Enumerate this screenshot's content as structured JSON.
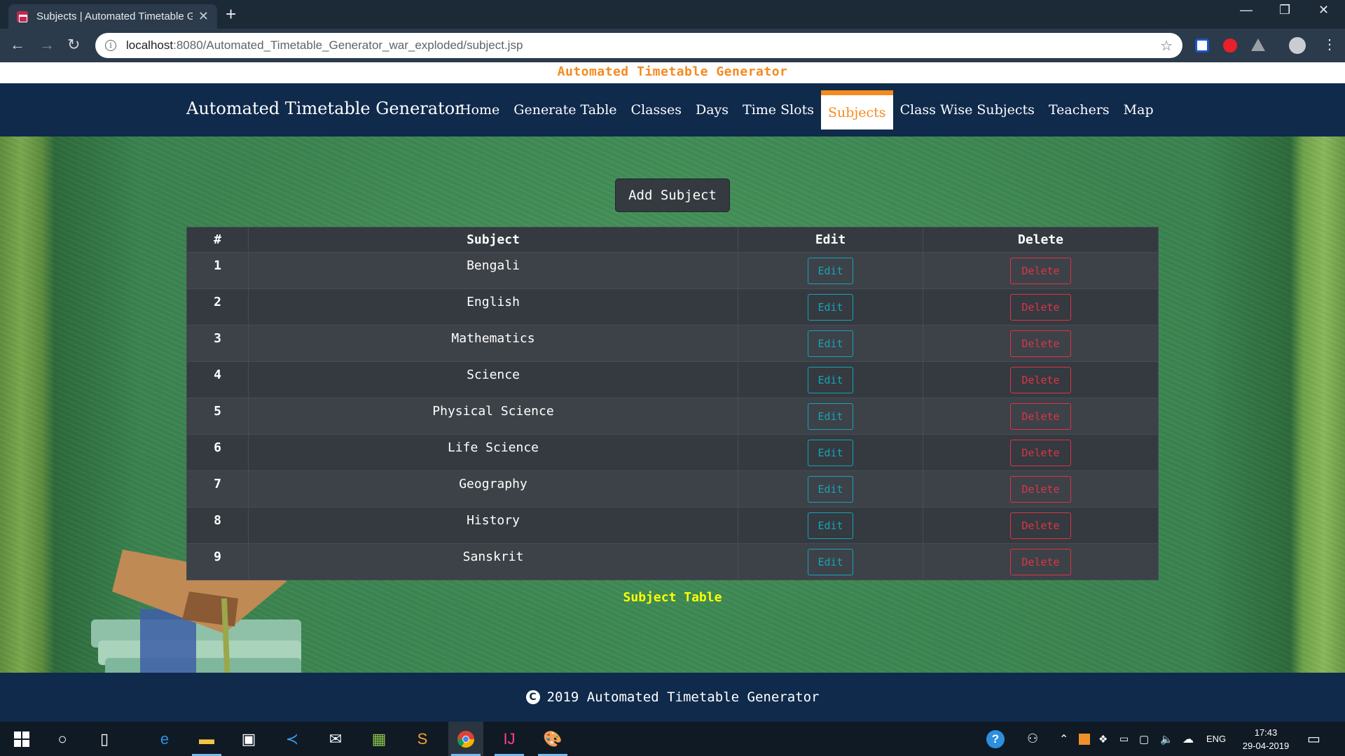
{
  "browser": {
    "tab_title": "Subjects | Automated Timetable G",
    "url_host": "localhost",
    "url_path": ":8080/Automated_Timetable_Generator_war_exploded/subject.jsp"
  },
  "page": {
    "top_banner": "Automated Timetable Generator",
    "brand": "Automated Timetable Generator",
    "nav": [
      {
        "label": "Home"
      },
      {
        "label": "Generate Table"
      },
      {
        "label": "Classes"
      },
      {
        "label": "Days"
      },
      {
        "label": "Time Slots"
      },
      {
        "label": "Subjects",
        "active": true
      },
      {
        "label": "Class Wise Subjects"
      },
      {
        "label": "Teachers"
      },
      {
        "label": "Map"
      }
    ],
    "add_button": "Add Subject",
    "table": {
      "headers": [
        "#",
        "Subject",
        "Edit",
        "Delete"
      ],
      "rows": [
        {
          "num": "1",
          "subject": "Bengali"
        },
        {
          "num": "2",
          "subject": "English"
        },
        {
          "num": "3",
          "subject": "Mathematics"
        },
        {
          "num": "4",
          "subject": "Science"
        },
        {
          "num": "5",
          "subject": "Physical Science"
        },
        {
          "num": "6",
          "subject": "Life Science"
        },
        {
          "num": "7",
          "subject": "Geography"
        },
        {
          "num": "8",
          "subject": "History"
        },
        {
          "num": "9",
          "subject": "Sanskrit"
        }
      ],
      "edit_label": "Edit",
      "delete_label": "Delete",
      "caption": "Subject Table"
    },
    "footer": "2019 Automated Timetable Generator",
    "footer_symbol": "C"
  },
  "taskbar": {
    "language": "ENG",
    "time": "17:43",
    "date": "29-04-2019"
  },
  "colors": {
    "accent": "#f58a1e",
    "navbar": "#0f2a4b",
    "table": "#343a40",
    "edit": "#17a2b8",
    "delete": "#dc3545",
    "caption": "#ffff00"
  }
}
